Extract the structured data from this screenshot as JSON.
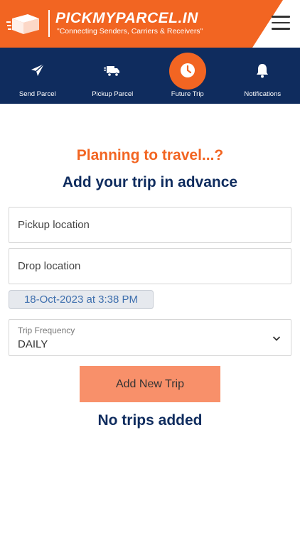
{
  "header": {
    "brand_name": "PICKMYPARCEL.IN",
    "tagline": "\"Connecting Senders, Carriers & Receivers\"",
    "logo_icon": "parcel-truck-logo",
    "menu_icon": "hamburger-menu-icon"
  },
  "nav": {
    "items": [
      {
        "label": "Send Parcel",
        "icon": "paper-plane-icon",
        "active": false
      },
      {
        "label": "Pickup Parcel",
        "icon": "truck-icon",
        "active": false
      },
      {
        "label": "Future Trip",
        "icon": "clock-icon",
        "active": true
      },
      {
        "label": "Notifications",
        "icon": "bell-icon",
        "active": false
      }
    ]
  },
  "main": {
    "planning_heading": "Planning to travel...?",
    "advance_heading": "Add your trip in advance",
    "pickup_placeholder": "Pickup location",
    "drop_placeholder": "Drop location",
    "date_time": "18-Oct-2023 at 3:38 PM",
    "frequency_label": "Trip Frequency",
    "frequency_value": "DAILY",
    "add_button_label": "Add New Trip",
    "empty_message": "No trips added"
  },
  "colors": {
    "brand_orange": "#f26522",
    "navy": "#0f2c5e",
    "button_orange": "#f8906a",
    "date_text": "#3e6fae"
  }
}
